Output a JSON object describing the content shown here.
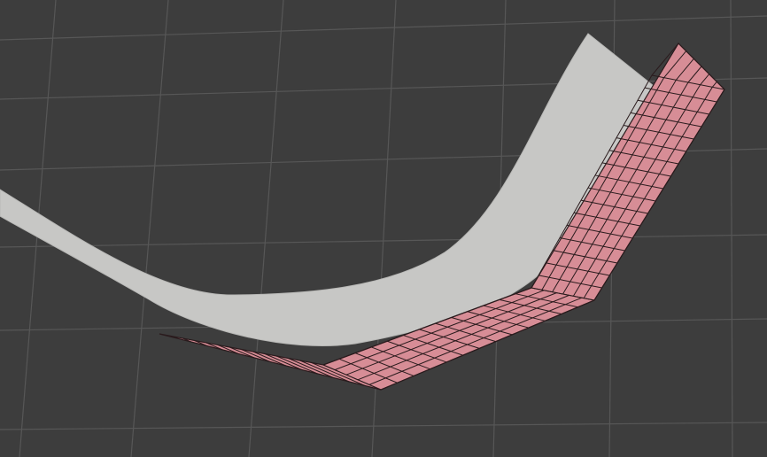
{
  "viewport": {
    "background_color": "#3d3d3d",
    "grid_color": "#575757"
  },
  "objects": [
    {
      "name": "curved-surface",
      "mode": "shaded",
      "color": "#c7c7c5",
      "shadow_color": "#bbbbba",
      "selected": false
    },
    {
      "name": "subdivided-surface",
      "mode": "wireframe-overlay",
      "color": "#d78d96",
      "edge_color": "#2a1b1d",
      "selected": true
    }
  ]
}
